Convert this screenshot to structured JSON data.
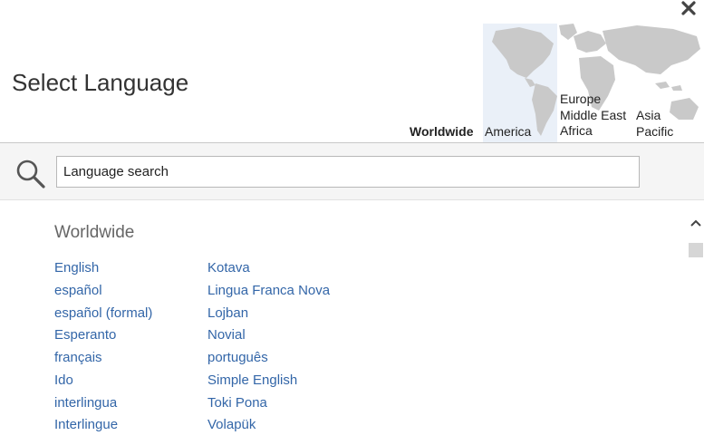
{
  "dialog": {
    "title": "Select Language",
    "close_icon": "close-icon"
  },
  "regions": {
    "worldwide": "Worldwide",
    "america": "America",
    "emea": [
      "Europe",
      "Middle East",
      "Africa"
    ],
    "asia": [
      "Asia",
      "Pacific"
    ],
    "selected": "Worldwide"
  },
  "search": {
    "placeholder": "Language search",
    "value": "",
    "icon": "search-icon"
  },
  "results": {
    "section_title": "Worldwide",
    "column1": [
      "English",
      "español",
      "español (formal)",
      "Esperanto",
      "français",
      "Ido",
      "interlingua",
      "Interlingue"
    ],
    "column2": [
      "Kotava",
      "Lingua Franca Nova",
      "Lojban",
      "Novial",
      "português",
      "Simple English",
      "Toki Pona",
      "Volapük"
    ]
  },
  "colors": {
    "link": "#3366a8",
    "selected_tab_underline": "#34669b",
    "region_highlight": "#eaf0f8",
    "map_land": "#c9c9c9"
  }
}
